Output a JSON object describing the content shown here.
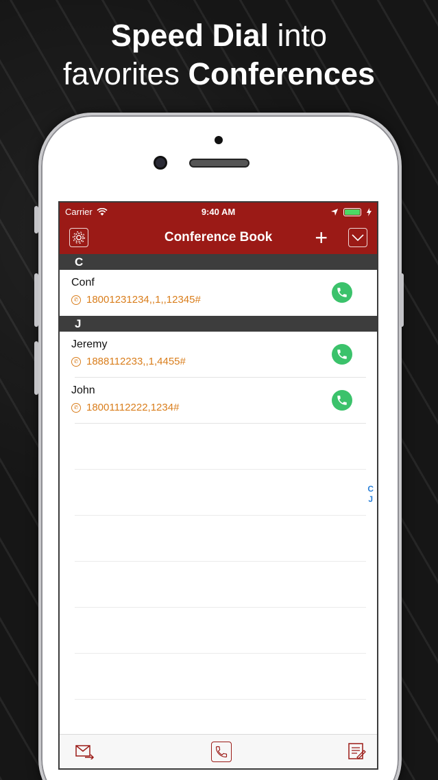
{
  "headline": {
    "line1_bold": "Speed Dial",
    "line1_rest": " into",
    "line2_rest": "favorites ",
    "line2_bold": "Conferences"
  },
  "status_bar": {
    "carrier": "Carrier",
    "time": "9:40 AM"
  },
  "nav": {
    "title": "Conference Book",
    "add_label": "+"
  },
  "sections": [
    {
      "letter": "C",
      "contacts": [
        {
          "name": "Conf",
          "number": "18001231234,,1,,12345#"
        }
      ]
    },
    {
      "letter": "J",
      "contacts": [
        {
          "name": "Jeremy",
          "number": "1888112233,,1,4455#"
        },
        {
          "name": "John",
          "number": "18001112222,1234#"
        }
      ]
    }
  ],
  "section_index": [
    "C",
    "J"
  ],
  "colors": {
    "brand": "#9b1a16",
    "number": "#d97d1b",
    "call": "#3bc26b",
    "index": "#2a80d8"
  },
  "icons": {
    "settings": "gear-icon",
    "add": "plus-icon",
    "menu": "chevron-down-icon",
    "call": "phone-icon",
    "toolbar": [
      "mail-send-icon",
      "phone-icon",
      "notes-icon"
    ]
  }
}
